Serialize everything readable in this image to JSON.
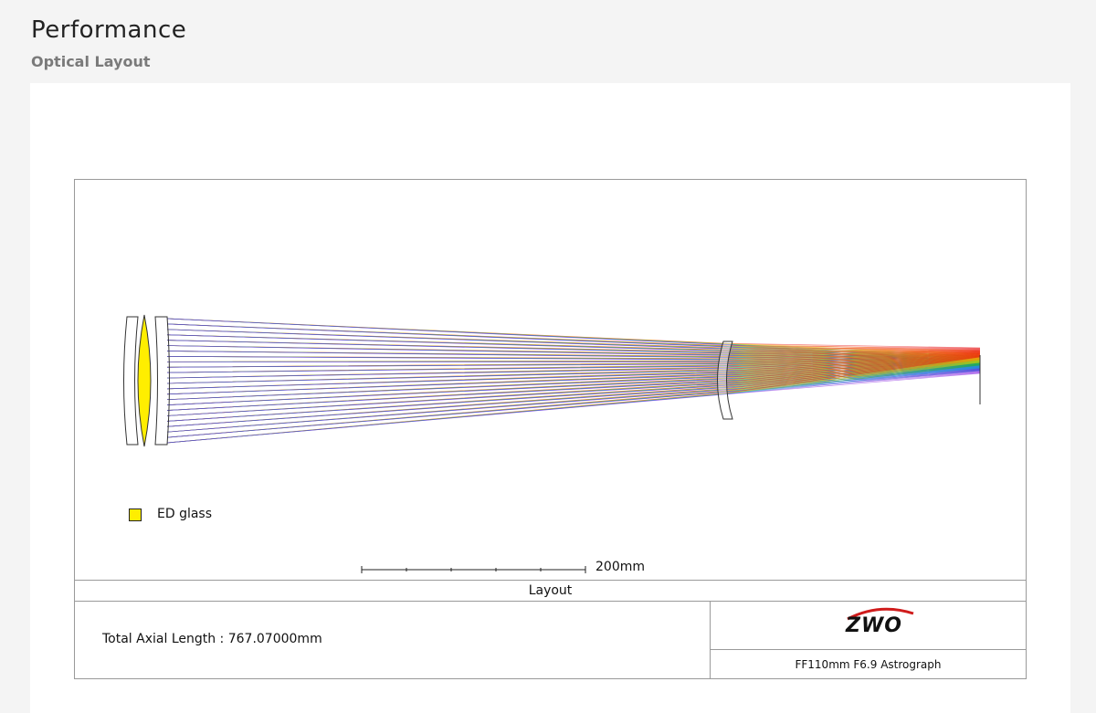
{
  "header": {
    "title": "Performance",
    "subtitle": "Optical Layout"
  },
  "diagram": {
    "legend": {
      "label": "ED glass",
      "color": "#ffee00"
    },
    "scale_bar": {
      "label": "200mm",
      "value_mm": 200,
      "divisions": 5
    },
    "layout_label": "Layout",
    "total_axial_length": "Total Axial Length : 767.07000mm",
    "logo": "ZWO",
    "model": "FF110mm F6.9 Astrograph",
    "ray_colors": [
      "#e81010",
      "#ff8a00",
      "#e0d000",
      "#22b822",
      "#12a7d8",
      "#2a4bd7",
      "#8a2be2"
    ]
  }
}
